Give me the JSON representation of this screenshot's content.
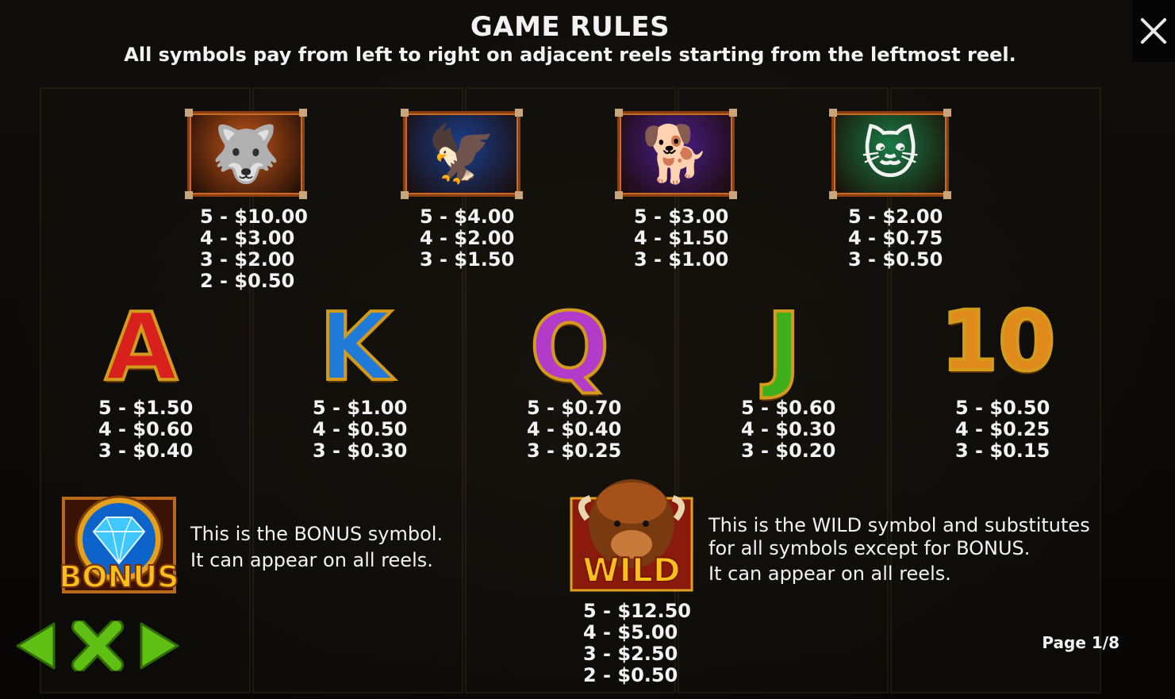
{
  "header": {
    "title": "GAME RULES",
    "subtitle": "All symbols pay from left to right on adjacent reels starting from the leftmost reel."
  },
  "close_icon": "close-icon",
  "high_symbols": [
    {
      "name": "wolf",
      "icon": "🐺",
      "bg": "#c2561a",
      "pays": [
        "5 - $10.00",
        "4 - $3.00",
        "3 - $2.00",
        "2 - $0.50"
      ]
    },
    {
      "name": "eagle",
      "icon": "🦅",
      "bg": "#1a3f8c",
      "pays": [
        "5 - $4.00",
        "4 - $2.00",
        "3 - $1.50"
      ]
    },
    {
      "name": "hyena",
      "icon": "🐕",
      "bg": "#4a1f8c",
      "pays": [
        "5 - $3.00",
        "4 - $1.50",
        "3 - $1.00"
      ]
    },
    {
      "name": "lynx",
      "icon": "🐱",
      "bg": "#1a7a45",
      "pays": [
        "5 - $2.00",
        "4 - $0.75",
        "3 - $0.50"
      ]
    }
  ],
  "low_symbols": [
    {
      "label": "A",
      "color": "#d8201c",
      "pays": [
        "5 - $1.50",
        "4 - $0.60",
        "3 - $0.40"
      ]
    },
    {
      "label": "K",
      "color": "#1f7ad8",
      "pays": [
        "5 - $1.00",
        "4 - $0.50",
        "3 - $0.30"
      ]
    },
    {
      "label": "Q",
      "color": "#b23cc9",
      "pays": [
        "5 - $0.70",
        "4 - $0.40",
        "3 - $0.25"
      ]
    },
    {
      "label": "J",
      "color": "#3fb01c",
      "pays": [
        "5 - $0.60",
        "4 - $0.30",
        "3 - $0.20"
      ]
    },
    {
      "label": "10",
      "color": "#e08a1c",
      "pays": [
        "5 - $0.50",
        "4 - $0.25",
        "3 - $0.15"
      ]
    }
  ],
  "bonus": {
    "logo_text": "BONUS",
    "line1": "This is the BONUS symbol.",
    "line2": "It can appear on all reels."
  },
  "wild": {
    "logo_text": "WILD",
    "line1": "This is the WILD symbol and substitutes",
    "line2": "for all symbols except for BONUS.",
    "line3": "It can appear on all reels.",
    "pays": [
      "5 - $12.50",
      "4 - $5.00",
      "3 - $2.50",
      "2 - $0.50"
    ]
  },
  "nav": {
    "page": "Page 1/8"
  },
  "colors": {
    "nav_green": "#5fbf12",
    "gold": "#f2b51c"
  }
}
